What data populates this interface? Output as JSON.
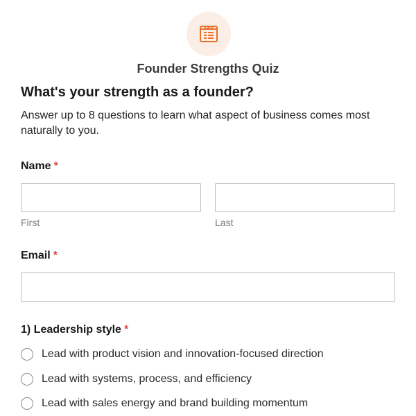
{
  "header": {
    "logo_icon": "quiz-list-icon",
    "logo_color": "#e8702a",
    "logo_bg": "#fbeee6",
    "quiz_name": "Founder Strengths Quiz"
  },
  "intro": {
    "title": "What's your strength as a founder?",
    "description": "Answer up to 8 questions to learn what aspect of business comes most naturally to you."
  },
  "name_field": {
    "label": "Name",
    "required_mark": "*",
    "first": {
      "value": "",
      "placeholder": "",
      "sublabel": "First"
    },
    "last": {
      "value": "",
      "placeholder": "",
      "sublabel": "Last"
    }
  },
  "email_field": {
    "label": "Email",
    "required_mark": "*",
    "value": "",
    "placeholder": ""
  },
  "question_1": {
    "label": "1) Leadership style",
    "required_mark": "*",
    "options": [
      {
        "label": "Lead with product vision and innovation-focused direction",
        "selected": false
      },
      {
        "label": "Lead with systems, process, and efficiency",
        "selected": false
      },
      {
        "label": "Lead with sales energy and brand building momentum",
        "selected": false
      }
    ]
  },
  "colors": {
    "required": "#d9443a",
    "input_border": "#bdbdbd",
    "sublabel": "#7a7a7a"
  }
}
